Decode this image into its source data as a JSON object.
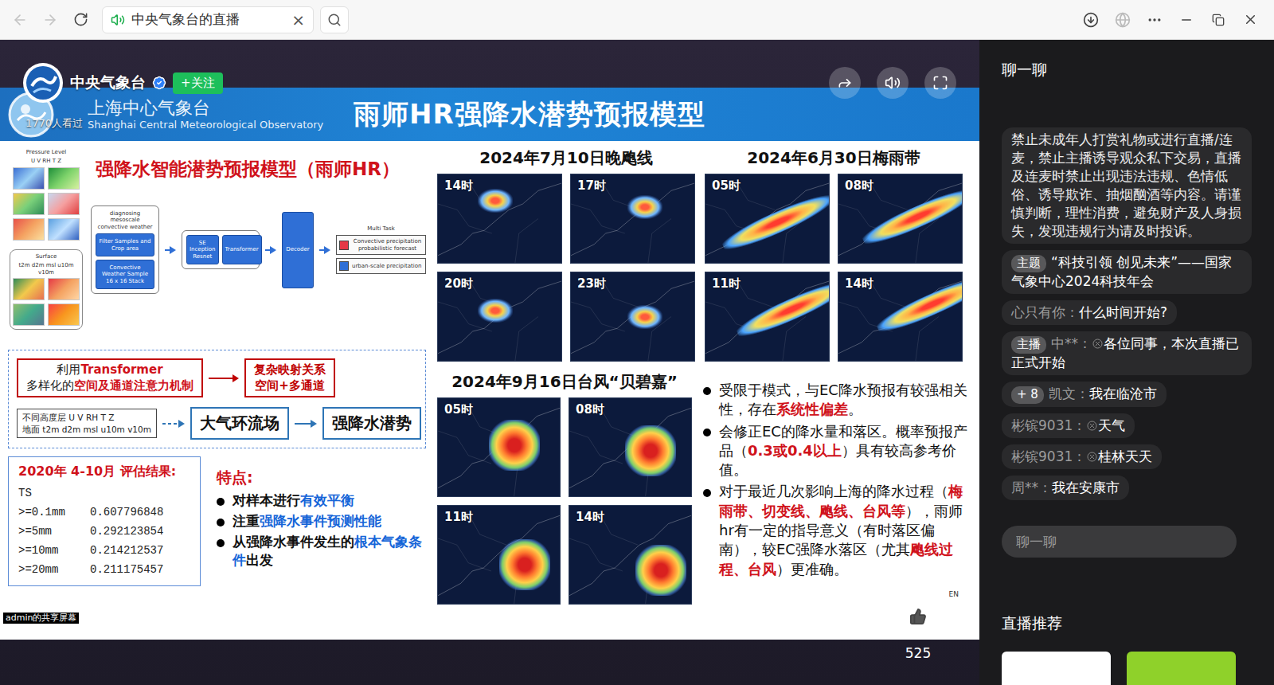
{
  "browser": {
    "tab_title": "中央气象台的直播",
    "tab_close": "×",
    "audio_playing": true,
    "back_enabled": false,
    "forward_enabled": false
  },
  "stream": {
    "channel": "中央气象台",
    "verified": true,
    "follow": "+关注",
    "views": "1770人看过",
    "likes": "525",
    "screen_share": "admin的共享屏幕"
  },
  "slide": {
    "org_cn": "上海中心气象台",
    "org_en": "Shanghai Central Meteorological Observatory",
    "title": "雨师HR强降水潜势预报模型",
    "model_title": "强降水智能潜势预报模型（雨师HR）",
    "diagram": {
      "pressure_label": "Pressure Level",
      "pressure_vars": "U V RH T Z",
      "surface_label": "Surface",
      "surface_vars": "t2m d2m msl u10m v10m",
      "stages": [
        {
          "title": "diagnosing mesoscale convective weather",
          "boxes": [
            "Filter Samples and Crop area",
            "Convective Weather Sample 16 x 16 Stack"
          ]
        },
        {
          "title": "",
          "boxes": [
            "SE Inception Resnet",
            "Transformer"
          ]
        }
      ],
      "decoder": "Decoder",
      "multi_task": "Multi Task",
      "outputs": [
        "Convective precipitation probabilistic forecast",
        "urban-scale precipitation"
      ]
    },
    "attention": [
      [
        {
          "text": "利用",
          "kind": "plain"
        },
        {
          "text": "Transformer",
          "kind": "red"
        }
      ],
      [
        {
          "text": "多样化的",
          "kind": "plain"
        },
        {
          "text": "空间及通道注意力机制",
          "kind": "red"
        }
      ]
    ],
    "mapping": [
      "复杂映射关系",
      "空间+多通道"
    ],
    "inputs": [
      "不同高度层 U V RH T Z",
      "地面 t2m d2m msl u10m v10m"
    ],
    "flow": [
      "大气环流场",
      "强降水潜势"
    ],
    "evaluation": {
      "title": "2020年 4-10月 评估结果:",
      "metric": "TS",
      "rows": [
        {
          "threshold": ">=0.1mm",
          "value": "0.607796848"
        },
        {
          "threshold": ">=5mm",
          "value": "0.292123854"
        },
        {
          "threshold": ">=10mm",
          "value": "0.214212537"
        },
        {
          "threshold": ">=20mm",
          "value": "0.211175457"
        }
      ]
    },
    "features": {
      "title": "特点:",
      "items": [
        [
          {
            "text": "对样本进行",
            "kind": "plain"
          },
          {
            "text": "有效平衡",
            "kind": "blue"
          }
        ],
        [
          {
            "text": "注重",
            "kind": "plain"
          },
          {
            "text": "强降水事件预测性能",
            "kind": "blue"
          }
        ],
        [
          {
            "text": "从强降水事件发生的",
            "kind": "plain"
          },
          {
            "text": "根本气象条件",
            "kind": "blue"
          },
          {
            "text": "出发",
            "kind": "plain"
          }
        ]
      ]
    },
    "cases": [
      {
        "title": "2024年7月10日晚飑线",
        "kind": "squall",
        "frames": [
          "14时",
          "17时",
          "20时",
          "23时"
        ]
      },
      {
        "title": "2024年6月30日梅雨带",
        "kind": "band",
        "frames": [
          "05时",
          "08时",
          "11时",
          "14时"
        ]
      },
      {
        "title": "2024年9月16日台风“贝碧嘉”",
        "kind": "typhoon",
        "frames": [
          "05时",
          "08时",
          "11时",
          "14时"
        ]
      }
    ],
    "notes": [
      [
        {
          "text": "受限于模式，与EC降水预报有较强相关性，存在",
          "kind": "plain"
        },
        {
          "text": "系统性偏差",
          "kind": "red"
        },
        {
          "text": "。",
          "kind": "plain"
        }
      ],
      [
        {
          "text": "会修正EC的降水量和落区。概率预报产品（",
          "kind": "plain"
        },
        {
          "text": "0.3或0.4以上",
          "kind": "red"
        },
        {
          "text": "）具有较高参考价值。",
          "kind": "plain"
        }
      ],
      [
        {
          "text": "对于最近几次影响上海的降水过程（",
          "kind": "plain"
        },
        {
          "text": "梅雨带、切变线、飑线、台风等",
          "kind": "red"
        },
        {
          "text": "），雨师hr有一定的指导意义（有时落区偏南），较EC强降水落区（尤其",
          "kind": "plain"
        },
        {
          "text": "飑线过程、台风",
          "kind": "red"
        },
        {
          "text": "）更准确。",
          "kind": "plain"
        }
      ]
    ],
    "lang_mark": "EN"
  },
  "chat": {
    "title": "聊一聊",
    "messages": [
      {
        "kind": "notice",
        "badge": "",
        "name": "",
        "has_icon": false,
        "text": "禁止未成年人打赏礼物或进行直播/连麦，禁止主播诱导观众私下交易，直播及连麦时禁止出现违法违规、色情低俗、诱导欺诈、抽烟酗酒等内容。请谨慎判断，理性消费，避免财产及人身损失，发现违规行为请及时投诉。"
      },
      {
        "kind": "topic",
        "badge": "主题",
        "name": "",
        "has_icon": false,
        "text": "“科技引领 创见未来”——国家气象中心2024科技年会"
      },
      {
        "kind": "user",
        "badge": "",
        "name": "心只有你：",
        "has_icon": false,
        "text": "什么时间开始?"
      },
      {
        "kind": "user",
        "badge": "主播",
        "name": "中**：",
        "has_icon": true,
        "text": "各位同事，本次直播已正式开始"
      },
      {
        "kind": "user",
        "badge": "+ 8",
        "name": "凯文：",
        "has_icon": false,
        "text": "我在临沧市"
      },
      {
        "kind": "user",
        "badge": "",
        "name": "彬镔9031：",
        "has_icon": true,
        "text": "天气"
      },
      {
        "kind": "user",
        "badge": "",
        "name": "彬镔9031：",
        "has_icon": true,
        "text": "桂林天天"
      },
      {
        "kind": "user",
        "badge": "",
        "name": "周**：",
        "has_icon": false,
        "text": "我在安康市"
      }
    ],
    "input_placeholder": "聊一聊",
    "recommend_title": "直播推荐",
    "recommendations": [
      {
        "color": "#ffffff"
      },
      {
        "color": "#8fd12a"
      }
    ]
  }
}
